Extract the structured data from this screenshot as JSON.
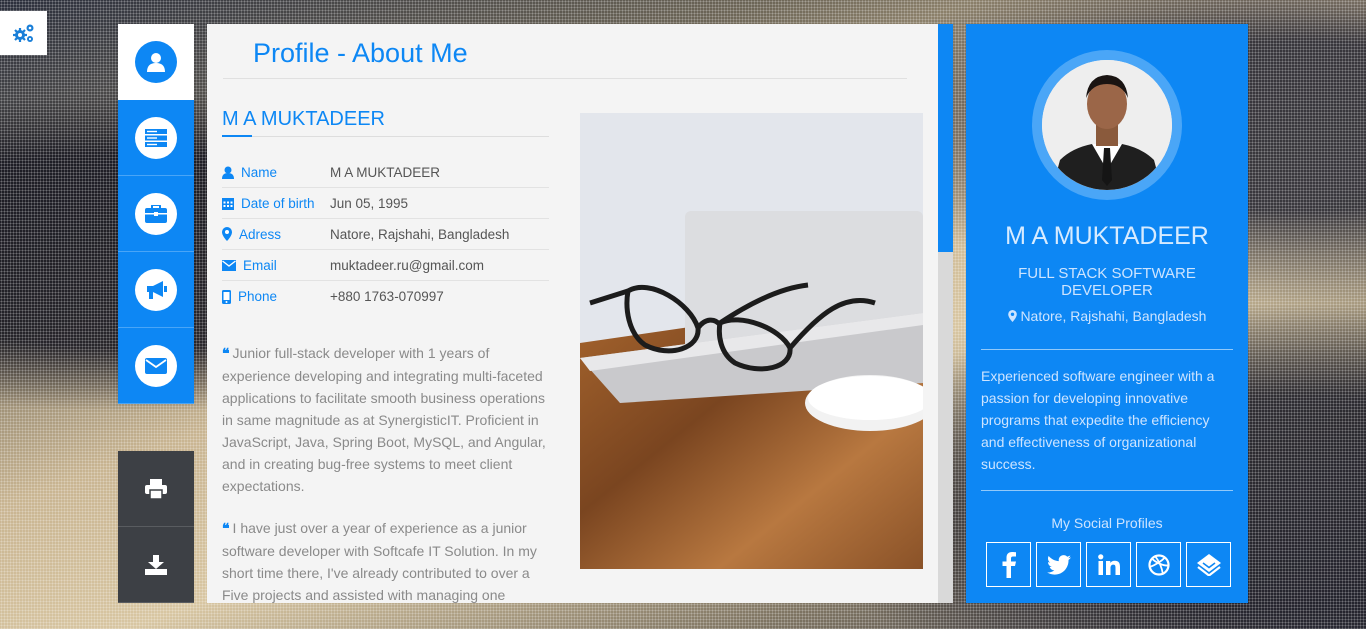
{
  "settings": {
    "icon": "gear-icon"
  },
  "nav": {
    "items": [
      {
        "icon": "user-icon",
        "name": "about"
      },
      {
        "icon": "server-icon",
        "name": "resume"
      },
      {
        "icon": "briefcase-icon",
        "name": "portfolio"
      },
      {
        "icon": "megaphone-icon",
        "name": "blog"
      },
      {
        "icon": "envelope-icon",
        "name": "contact"
      }
    ],
    "tools": [
      {
        "icon": "print-icon"
      },
      {
        "icon": "download-icon"
      }
    ]
  },
  "main": {
    "title": "Profile - About Me",
    "name": "M A MUKTADEER",
    "info": [
      {
        "label": "Name",
        "value": "M A MUKTADEER",
        "icon": "user-icon"
      },
      {
        "label": "Date of birth",
        "value": "Jun 05, 1995",
        "icon": "calendar-icon"
      },
      {
        "label": "Adress",
        "value": "Natore, Rajshahi, Bangladesh",
        "icon": "map-marker-icon"
      },
      {
        "label": "Email",
        "value": "muktadeer.ru@gmail.com",
        "icon": "envelope-icon"
      },
      {
        "label": "Phone",
        "value": "+880 1763-070997",
        "icon": "phone-icon"
      }
    ],
    "bio": [
      "Junior full-stack developer with 1 years of experience developing and integrating multi-faceted applications to facilitate smooth business operations in same magnitude as at SynergisticIT. Proficient in JavaScript, Java, Spring Boot, MySQL, and Angular, and in creating bug-free systems to meet client expectations.",
      "I have just over a year of experience as a junior software developer with Softcafe IT Solution. In my short time there, I've already contributed to over a Five projects and assisted with managing one"
    ]
  },
  "card": {
    "name": "M A MUKTADEER",
    "role": "FULL STACK SOFTWARE DEVELOPER",
    "location": "Natore, Rajshahi, Bangladesh",
    "description": "Experienced software engineer with a passion for developing innovative programs that expedite the efficiency and effectiveness of organizational success.",
    "social_title": "My Social Profiles",
    "social": [
      "facebook-icon",
      "twitter-icon",
      "linkedin-icon",
      "dribbble-icon",
      "stack-icon"
    ]
  },
  "colors": {
    "accent": "#0d87f4",
    "tool_bg": "#3d4045",
    "panel_bg": "#f4f4f4"
  }
}
